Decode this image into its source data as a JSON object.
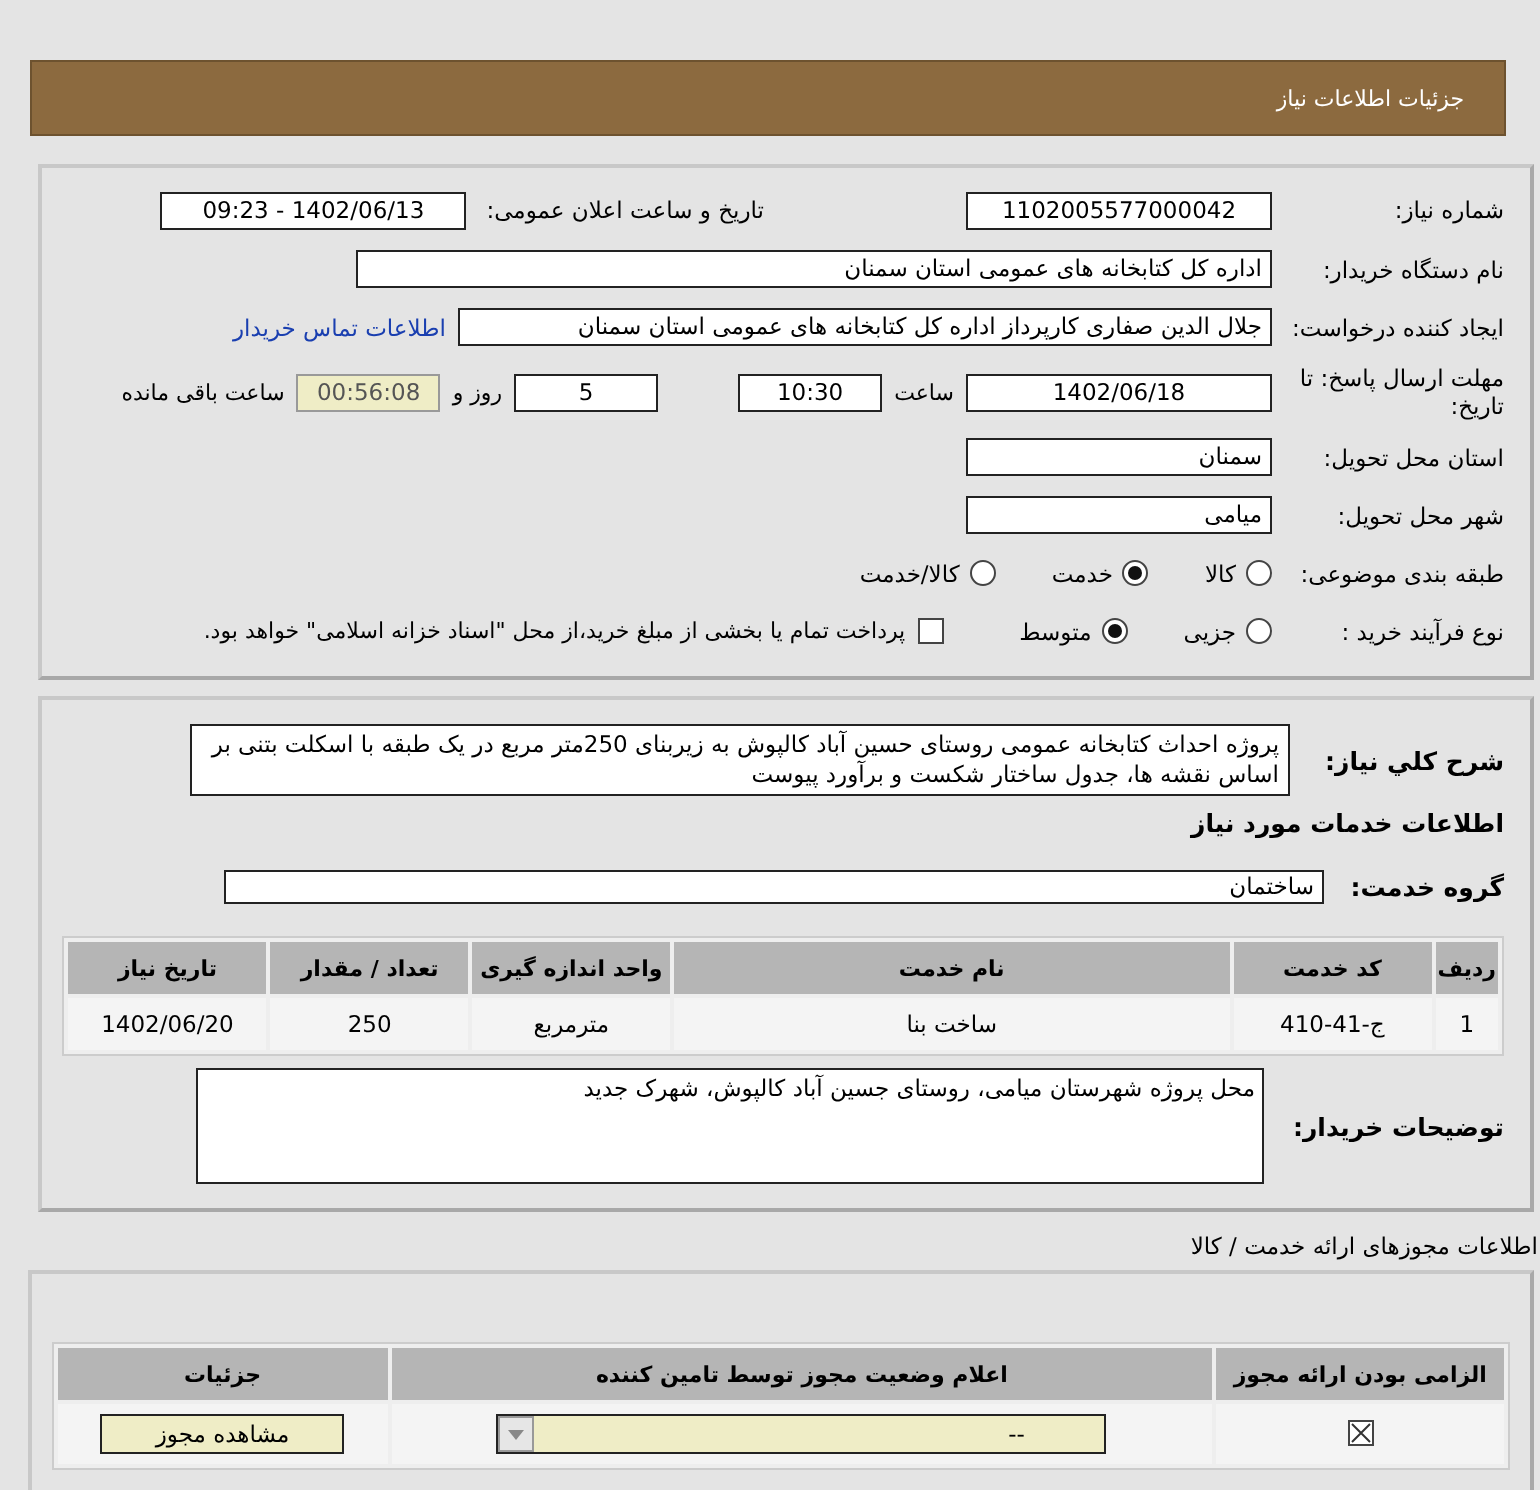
{
  "header": {
    "title": "جزئیات اطلاعات نیاز"
  },
  "details": {
    "need_number": {
      "label": "شماره نیاز:",
      "value": "1102005577000042"
    },
    "announce": {
      "label": "تاریخ و ساعت اعلان عمومی:",
      "value": "1402/06/13 - 09:23"
    },
    "buyer": {
      "label": "نام دستگاه خریدار:",
      "value": "اداره کل کتابخانه های عمومی استان سمنان"
    },
    "requester": {
      "label": "ایجاد کننده درخواست:",
      "value": "جلال الدین صفاری کارپرداز اداره کل کتابخانه های عمومی استان سمنان",
      "link": "اطلاعات تماس خریدار"
    },
    "deadline": {
      "label": "مهلت ارسال پاسخ: تا تاریخ:",
      "date": "1402/06/18",
      "time_label": "ساعت",
      "time": "10:30",
      "days": "5",
      "days_label": "روز و",
      "remaining": "00:56:08",
      "remaining_label": "ساعت باقی مانده"
    },
    "province": {
      "label": "استان محل تحویل:",
      "value": "سمنان"
    },
    "city": {
      "label": "شهر محل تحویل:",
      "value": "میامی"
    },
    "category": {
      "label": "طبقه بندی موضوعی:",
      "options": [
        {
          "label": "کالا",
          "selected": false
        },
        {
          "label": "خدمت",
          "selected": true
        },
        {
          "label": "کالا/خدمت",
          "selected": false
        }
      ]
    },
    "process": {
      "label": "نوع فرآیند خرید :",
      "options": [
        {
          "label": "جزیی",
          "selected": false
        },
        {
          "label": "متوسط",
          "selected": true
        }
      ],
      "payment": {
        "checked": false,
        "text": "پرداخت تمام یا بخشی از مبلغ خرید،از محل \"اسناد خزانه اسلامی\" خواهد بود."
      }
    }
  },
  "description": {
    "label": "شرح کلي نياز:",
    "text": "پروژه احداث کتابخانه عمومی روستای حسین آباد کالپوش به زیربنای 250متر مربع در یک طبقه با اسکلت بتنی بر اساس نقشه ها، جدول ساختار شکست و برآورد پیوست"
  },
  "services": {
    "title": "اطلاعات خدمات مورد نیاز",
    "group_label": "گروه خدمت:",
    "group": "ساختمان",
    "columns": [
      "ردیف",
      "کد خدمت",
      "نام خدمت",
      "واحد اندازه گیری",
      "تعداد / مقدار",
      "تاریخ نیاز"
    ],
    "rows": [
      [
        "1",
        "ج-41-410",
        "ساخت بنا",
        "مترمربع",
        "250",
        "1402/06/20"
      ]
    ]
  },
  "buyer_notes": {
    "label": "توضیحات خریدار:",
    "text": "محل پروژه شهرستان میامی، روستای جسین آباد کالپوش، شهرک جدید"
  },
  "permits": {
    "title": "اطلاعات مجوزهای ارائه خدمت / کالا",
    "columns": [
      "الزامی بودن ارائه مجوز",
      "اعلام وضعیت مجوز توسط تامین کننده",
      "جزئیات"
    ],
    "rows": [
      {
        "required": true,
        "status": "--",
        "button": "مشاهده مجوز"
      }
    ]
  }
}
